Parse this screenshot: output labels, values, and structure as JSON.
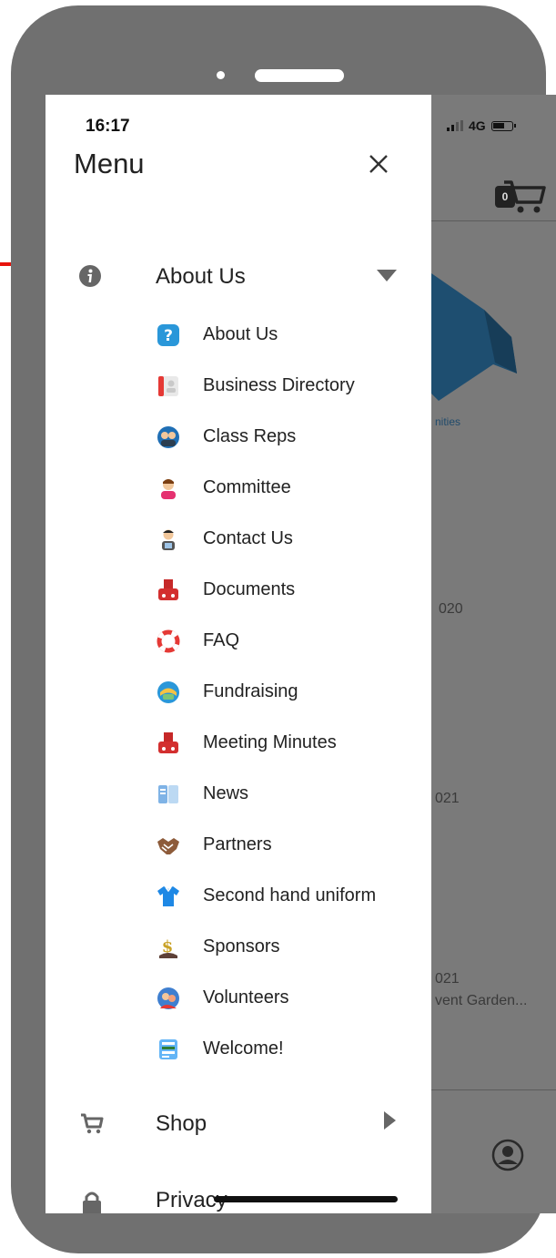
{
  "status_bar": {
    "time": "16:17",
    "network": "4G"
  },
  "drawer": {
    "title": "Menu",
    "sections": [
      {
        "label": "About Us",
        "icon": "info-icon",
        "expanded": true
      },
      {
        "label": "Shop",
        "icon": "cart-icon",
        "expanded": false
      },
      {
        "label": "Privacy",
        "icon": "lock-icon",
        "expanded": false
      }
    ],
    "sub_items": [
      {
        "label": "About Us",
        "icon": "question-icon"
      },
      {
        "label": "Business Directory",
        "icon": "directory-icon"
      },
      {
        "label": "Class Reps",
        "icon": "class-reps-icon"
      },
      {
        "label": "Committee",
        "icon": "committee-icon"
      },
      {
        "label": "Contact Us",
        "icon": "contact-icon"
      },
      {
        "label": "Documents",
        "icon": "documents-icon"
      },
      {
        "label": "FAQ",
        "icon": "lifebuoy-icon"
      },
      {
        "label": "Fundraising",
        "icon": "fundraising-icon"
      },
      {
        "label": "Meeting Minutes",
        "icon": "minutes-icon"
      },
      {
        "label": "News",
        "icon": "news-icon"
      },
      {
        "label": "Partners",
        "icon": "handshake-icon"
      },
      {
        "label": "Second hand uniform",
        "icon": "shirt-icon"
      },
      {
        "label": "Sponsors",
        "icon": "sponsor-icon"
      },
      {
        "label": "Volunteers",
        "icon": "volunteers-icon"
      },
      {
        "label": "Welcome!",
        "icon": "welcome-icon"
      }
    ]
  },
  "background_app": {
    "cart_count": "0",
    "caption": "nities",
    "fragments": [
      "020",
      "021",
      "021",
      "vent Garden..."
    ]
  },
  "colors": {
    "annotation_arrow": "#e8130c",
    "phone_bezel": "#707070",
    "dim_overlay": "#7a7a7a"
  }
}
